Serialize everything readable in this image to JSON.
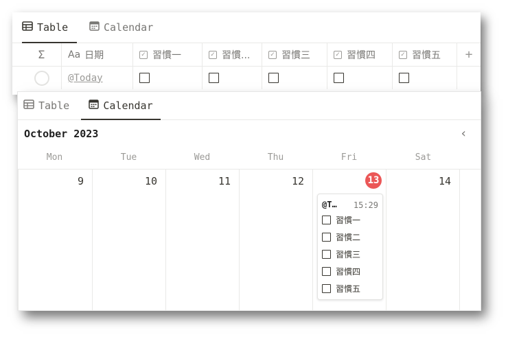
{
  "back_view": {
    "tabs": [
      {
        "icon": "table-icon",
        "label": "Table",
        "active": true
      },
      {
        "icon": "calendar-icon",
        "label": "Calendar",
        "active": false
      }
    ],
    "columns": [
      {
        "icon": "sigma-icon",
        "label": "Σ"
      },
      {
        "icon": "text-property-icon",
        "prefix": "Aa",
        "label": "日期"
      },
      {
        "icon": "checkbox-property-icon",
        "label": "習慣一"
      },
      {
        "icon": "checkbox-property-icon",
        "label": "習慣..."
      },
      {
        "icon": "checkbox-property-icon",
        "label": "習慣三"
      },
      {
        "icon": "checkbox-property-icon",
        "label": "習慣四"
      },
      {
        "icon": "checkbox-property-icon",
        "label": "習慣五"
      }
    ],
    "add_column": "+",
    "row": {
      "date": "@Today",
      "checks": [
        false,
        false,
        false,
        false,
        false
      ]
    }
  },
  "front_view": {
    "tabs": [
      {
        "icon": "table-icon",
        "label": "Table",
        "active": false
      },
      {
        "icon": "calendar-icon",
        "label": "Calendar",
        "active": true
      }
    ],
    "month_title": "October 2023",
    "prev_label": "‹",
    "weekdays": [
      "Mon",
      "Tue",
      "Wed",
      "Thu",
      "Fri",
      "Sat"
    ],
    "days": [
      "9",
      "10",
      "11",
      "12",
      "13",
      "14"
    ],
    "today": "13",
    "event": {
      "title": "@T…",
      "time": "15:29",
      "habits": [
        "習慣一",
        "習慣二",
        "習慣三",
        "習慣四",
        "習慣五"
      ]
    }
  },
  "colors": {
    "today": "#eb5757",
    "text": "#37352f",
    "muted": "#787774"
  }
}
